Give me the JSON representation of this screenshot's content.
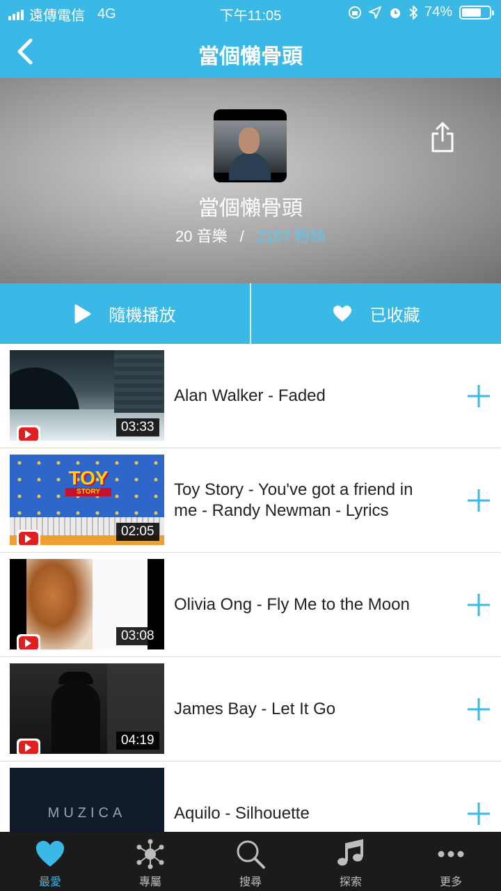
{
  "status_bar": {
    "carrier": "遠傳電信",
    "network": "4G",
    "time": "下午11:05",
    "battery": "74%",
    "battery_level": 0.74
  },
  "nav": {
    "title": "當個懶骨頭"
  },
  "header": {
    "name": "當個懶骨頭",
    "music_count": "20 音樂",
    "separator": "/",
    "fans": "2167 粉絲"
  },
  "actions": {
    "shuffle": "隨機播放",
    "favorited": "已收藏"
  },
  "songs": [
    {
      "title": "Alan Walker - Faded",
      "duration": "03:33"
    },
    {
      "title": "Toy Story - You've got a friend in me - Randy Newman - Lyrics",
      "duration": "02:05"
    },
    {
      "title": "Olivia Ong - Fly Me to the Moon",
      "duration": "03:08"
    },
    {
      "title": "James Bay - Let It Go",
      "duration": "04:19"
    },
    {
      "title": "Aquilo - Silhouette",
      "duration": "",
      "thumb_text": "MUZICA"
    }
  ],
  "thumbs": {
    "toy_story_logo_top": "TOY",
    "toy_story_logo_bottom": "STORY"
  },
  "tabs": [
    {
      "label": "最愛",
      "icon": "heart-icon",
      "active": true
    },
    {
      "label": "專屬",
      "icon": "network-icon"
    },
    {
      "label": "搜尋",
      "icon": "search-icon"
    },
    {
      "label": "探索",
      "icon": "music-note-icon"
    },
    {
      "label": "更多",
      "icon": "more-icon"
    }
  ],
  "colors": {
    "accent": "#3ab8e6",
    "fans": "#5bc7f0",
    "tabbar": "#1b1b1b"
  }
}
